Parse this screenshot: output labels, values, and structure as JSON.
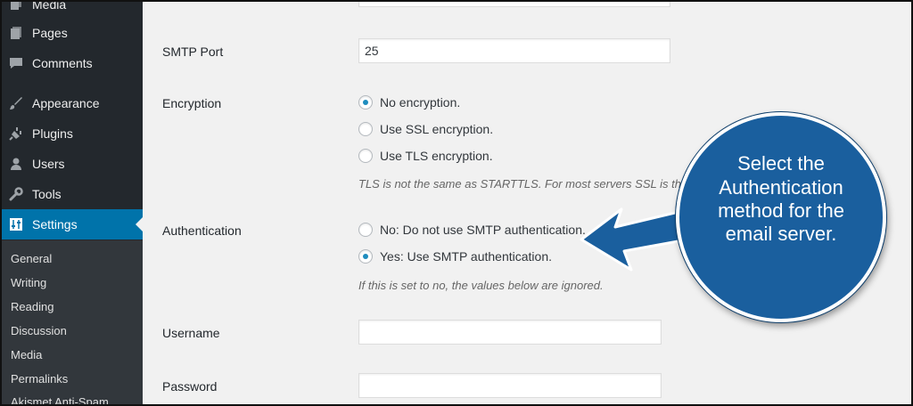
{
  "sidebar": {
    "items": [
      {
        "label": "Media",
        "icon": "media-icon"
      },
      {
        "label": "Pages",
        "icon": "pages-icon"
      },
      {
        "label": "Comments",
        "icon": "comments-icon"
      },
      {
        "label": "Appearance",
        "icon": "appearance-icon"
      },
      {
        "label": "Plugins",
        "icon": "plugins-icon"
      },
      {
        "label": "Users",
        "icon": "users-icon"
      },
      {
        "label": "Tools",
        "icon": "tools-icon"
      },
      {
        "label": "Settings",
        "icon": "settings-icon",
        "active": true
      }
    ],
    "submenu": [
      "General",
      "Writing",
      "Reading",
      "Discussion",
      "Media",
      "Permalinks",
      "Akismet Anti-Spam"
    ]
  },
  "form": {
    "smtp_port_label": "SMTP Port",
    "smtp_port_value": "25",
    "encryption_label": "Encryption",
    "encryption_options": [
      "No encryption.",
      "Use SSL encryption.",
      "Use TLS encryption."
    ],
    "encryption_selected": 0,
    "encryption_note": "TLS is not the same as STARTTLS. For most servers SSL is the",
    "authentication_label": "Authentication",
    "authentication_options": [
      "No: Do not use SMTP authentication.",
      "Yes: Use SMTP authentication."
    ],
    "authentication_selected": 1,
    "authentication_note": "If this is set to no, the values below are ignored.",
    "username_label": "Username",
    "username_value": "",
    "password_label": "Password",
    "password_value": ""
  },
  "callout": {
    "text": "Select the Authentication method for the email server."
  },
  "colors": {
    "sidebar_bg": "#23282d",
    "active_bg": "#0073aa",
    "callout_bg": "#1a5f9e"
  }
}
